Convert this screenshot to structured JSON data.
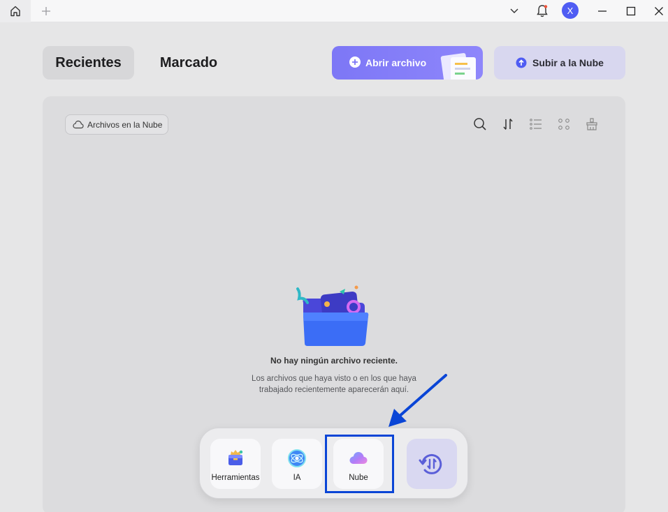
{
  "titlebar": {
    "home_icon": "home-icon",
    "new_tab_icon": "plus-icon",
    "icons": [
      "chevron-down-icon",
      "bell-icon",
      "minimize-icon",
      "maximize-icon",
      "close-icon"
    ],
    "avatar_letter": "X"
  },
  "tabs": {
    "recent": "Recientes",
    "starred": "Marcado"
  },
  "actions": {
    "open_file": "Abrir archivo",
    "upload_cloud": "Subir a la Nube"
  },
  "filter_chip": "Archivos en la Nube",
  "toolbar_icons": [
    "search-icon",
    "sort-icon",
    "list-view-icon",
    "grid-view-icon",
    "clean-icon"
  ],
  "empty_state": {
    "title": "No hay ningún archivo reciente.",
    "description": "Los archivos que haya visto o en los que haya trabajado recientemente aparecerán aquí."
  },
  "dock": {
    "tools": "Herramientas",
    "ai": "IA",
    "cloud": "Nube"
  },
  "colors": {
    "accent": "#7d77f6",
    "highlight": "#0a45d6",
    "avatar": "#4f5cf3"
  }
}
